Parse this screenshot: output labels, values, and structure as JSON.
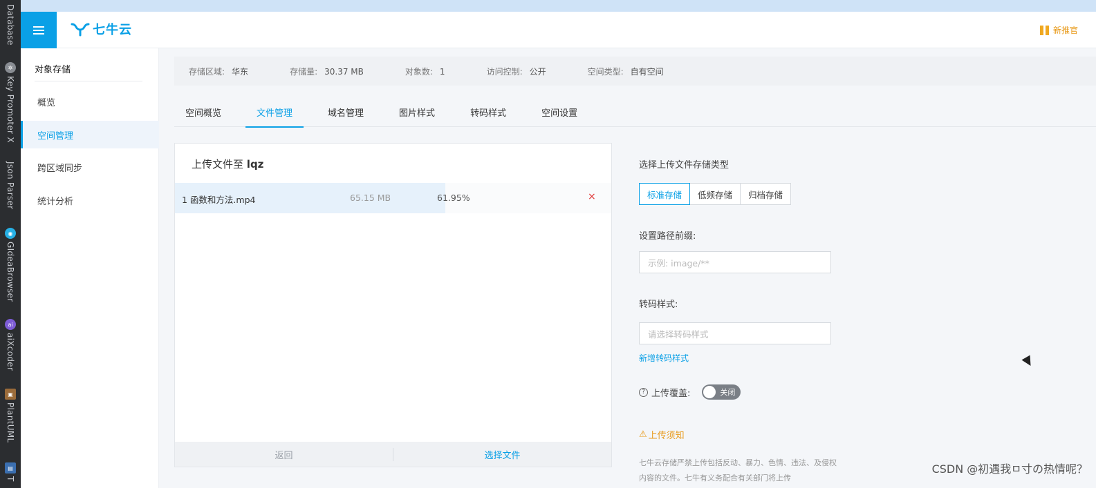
{
  "ide_tabs": [
    {
      "label": "Database",
      "icon": "database-icon",
      "color": "#2b2d30"
    },
    {
      "label": "Key Promoter X",
      "icon": "key-promoter-icon",
      "color": "#888c92"
    },
    {
      "label": "Json Parser",
      "icon": "json-parser-icon",
      "color": "#2b2d30"
    },
    {
      "label": "GIdeaBrowser",
      "icon": "browser-icon",
      "color": "#27b0e5"
    },
    {
      "label": "aiXcoder",
      "icon": "aixcoder-icon",
      "color": "#7d5cd6"
    },
    {
      "label": "PlantUML",
      "icon": "plantuml-icon",
      "color": "#9a6b3a"
    },
    {
      "label": "T",
      "icon": "t-icon",
      "color": "#3b6fb0"
    }
  ],
  "header": {
    "logo_text": "七牛云",
    "news_label": "新推官"
  },
  "sidebar": {
    "title": "对象存储",
    "items": [
      {
        "label": "概览",
        "active": false
      },
      {
        "label": "空间管理",
        "active": true
      },
      {
        "label": "跨区域同步",
        "active": false
      },
      {
        "label": "统计分析",
        "active": false
      }
    ]
  },
  "info_bar": {
    "items": [
      {
        "key": "存储区域:",
        "value": "华东"
      },
      {
        "key": "存储量:",
        "value": "30.37 MB"
      },
      {
        "key": "对象数:",
        "value": "1"
      },
      {
        "key": "访问控制:",
        "value": "公开"
      },
      {
        "key": "空间类型:",
        "value": "自有空间"
      }
    ]
  },
  "tabs": [
    {
      "label": "空间概览",
      "active": false
    },
    {
      "label": "文件管理",
      "active": true
    },
    {
      "label": "域名管理",
      "active": false
    },
    {
      "label": "图片样式",
      "active": false
    },
    {
      "label": "转码样式",
      "active": false
    },
    {
      "label": "空间设置",
      "active": false
    }
  ],
  "upload": {
    "title_prefix": "上传文件至",
    "bucket": "lqz",
    "file": {
      "name": "1 函数和方法.mp4",
      "size": "65.15 MB",
      "progress_text": "61.95%",
      "progress": 0.6195,
      "delete_label": "×"
    },
    "back_label": "返回",
    "choose_label": "选择文件"
  },
  "form": {
    "storage_type_label": "选择上传文件存储类型",
    "storage_types": [
      "标准存储",
      "低频存储",
      "归档存储"
    ],
    "storage_type_selected": "标准存储",
    "prefix_label": "设置路径前缀:",
    "prefix_placeholder": "示例: image/**",
    "transcode_label": "转码样式:",
    "transcode_placeholder": "请选择转码样式",
    "add_transcode_link": "新增转码样式",
    "overwrite_label": "上传覆盖:",
    "overwrite_state": "关闭",
    "notice_title": "上传须知",
    "notice_text": "七牛云存储严禁上传包括反动、暴力、色情、违法、及侵权内容的文件。七牛有义务配合有关部门将上传"
  },
  "watermark": "CSDN @初遇我ㅁ寸の热情呢？",
  "colors": {
    "accent": "#0aa0e6",
    "warning": "#e89a1a",
    "danger": "#e03434"
  }
}
